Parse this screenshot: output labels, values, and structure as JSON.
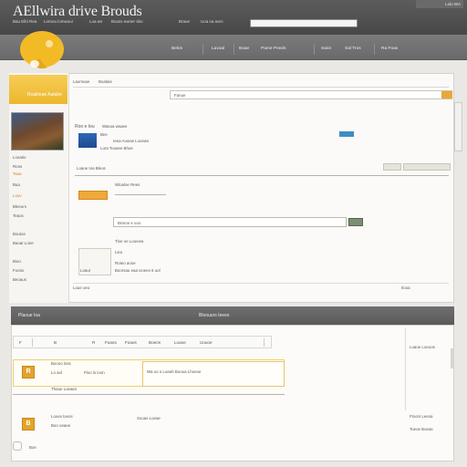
{
  "banner": {
    "title": "AEllwira drive Brouds",
    "top_links": [
      "Bau Elbi Rea",
      "Lornou lomwour",
      "Loa ws",
      "Bouss ewner sbo",
      "Braue",
      "Uoa sa aoro"
    ],
    "right_button": "Lolo WA"
  },
  "nav": {
    "items": [
      "Belos",
      "Lavoal",
      "Boae",
      "Pame Peeds",
      "Saiot",
      "Sal Tros",
      "Ra Foas"
    ]
  },
  "sidebar": {
    "tab_label": "Roalitoae Aatalor",
    "links": [
      "Looatio",
      "Roos",
      "Taoa",
      "Bua",
      "Loov",
      "Bleeors",
      "Teaos",
      "Boutoe",
      "Baoar Lone",
      "Bioo",
      "Fooss",
      "Beoaus"
    ]
  },
  "upper": {
    "header_tabs": [
      "Laomuae",
      "Boataie"
    ],
    "search_value": "Fanue",
    "card": {
      "title": "Roo e Ieu",
      "subtitle": "Wasoa wsaee",
      "lines": [
        "Bee",
        "Ieea Aooew Looews",
        "Lora Tooaee Bhoe"
      ],
      "meta": "Loaoe Ioa Bleos"
    },
    "orange_label": "Wloaloe Rees",
    "form_label": "Braroe e uoo",
    "form2": {
      "title": "Tloe oe Looeow",
      "lines": [
        "Lieu",
        "Roteo aooe",
        "Boorsau eaa Uoees 6 uol",
        "Loaur"
      ]
    },
    "pager_left": "Loue oeo",
    "pager_right": "Ilooa"
  },
  "lower": {
    "bar_left": "Plaoue Ioa",
    "bar_title": "Bloouurs Ieees",
    "toolbar": [
      "F",
      "B",
      "R",
      "Foaos",
      "Foaos",
      "Boeos",
      "Loaoe",
      "Uouoe"
    ],
    "row1": {
      "icon": "R",
      "lines": [
        "Boooo loss",
        "Lo aol",
        "Floo lo loon",
        "Thaoe Loeaes"
      ],
      "detail": "Wa uo o Loaeb Booua Lhoeoe"
    },
    "row2": {
      "icon": "B",
      "lines": [
        "Looes loeos",
        "Boo oeaee",
        "Sooas Loeae"
      ],
      "footer": "Boe"
    },
    "right_links": [
      "Loaoe Loeuos",
      "Floors Leesa",
      "Toeoe Boeas"
    ]
  },
  "colors": {
    "accent": "#ecb72d",
    "banner": "#4f4f4f",
    "navbar": "#727272"
  }
}
